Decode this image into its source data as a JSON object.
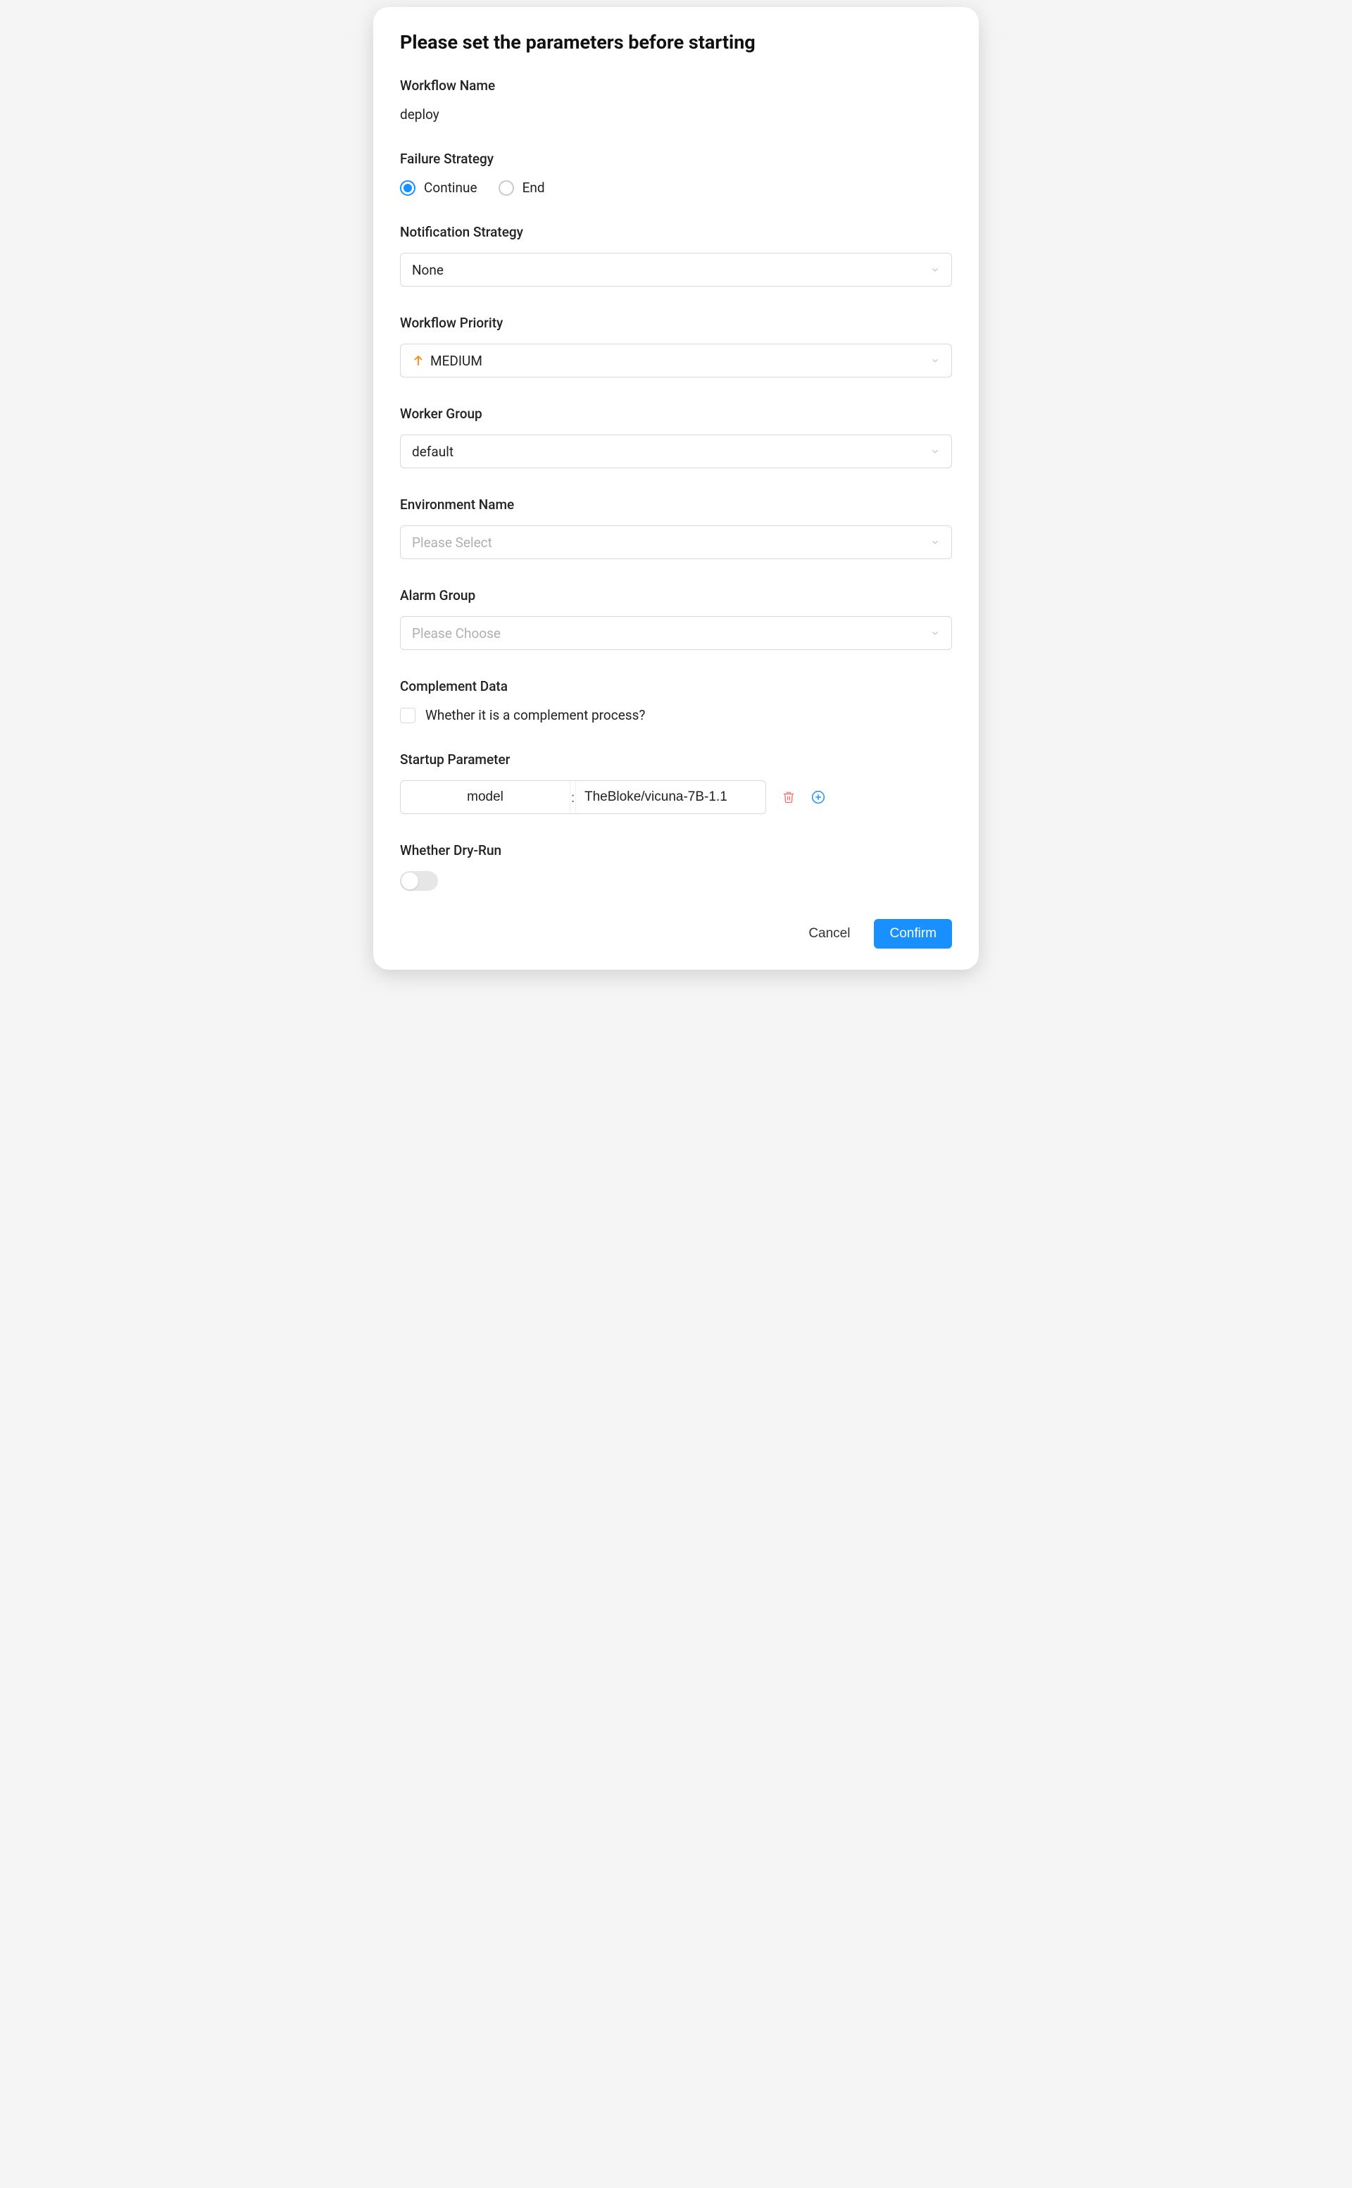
{
  "modal": {
    "title": "Please set the parameters before starting"
  },
  "workflow_name": {
    "label": "Workflow Name",
    "value": "deploy"
  },
  "failure_strategy": {
    "label": "Failure Strategy",
    "options": {
      "continue": "Continue",
      "end": "End"
    },
    "selected": "continue"
  },
  "notification_strategy": {
    "label": "Notification Strategy",
    "value": "None"
  },
  "workflow_priority": {
    "label": "Workflow Priority",
    "value": "MEDIUM"
  },
  "worker_group": {
    "label": "Worker Group",
    "value": "default"
  },
  "environment_name": {
    "label": "Environment Name",
    "placeholder": "Please Select"
  },
  "alarm_group": {
    "label": "Alarm Group",
    "placeholder": "Please Choose"
  },
  "complement_data": {
    "label": "Complement Data",
    "checkbox_label": "Whether it is a complement process?",
    "checked": false
  },
  "startup_parameter": {
    "label": "Startup Parameter",
    "params": [
      {
        "key": "model",
        "value": "TheBloke/vicuna-7B-1.1"
      }
    ]
  },
  "dry_run": {
    "label": "Whether Dry-Run",
    "value": false
  },
  "footer": {
    "cancel": "Cancel",
    "confirm": "Confirm"
  }
}
